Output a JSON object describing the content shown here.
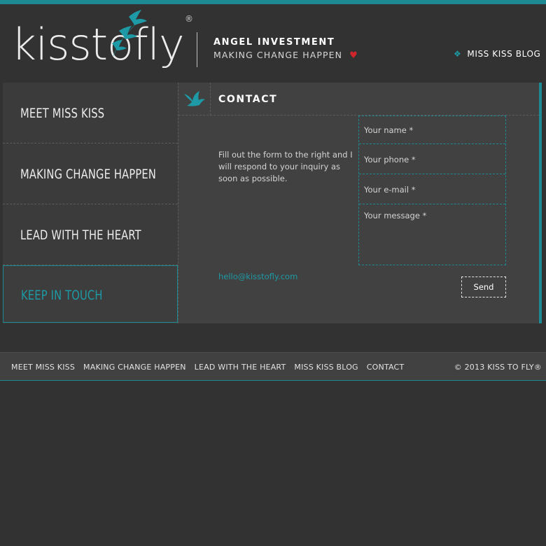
{
  "brand": {
    "logo_text": "kisstofly",
    "registered_mark": "®",
    "logo_icon": "birds-icon",
    "accent_color": "#1d8a93",
    "heart_color": "#d0262b"
  },
  "header": {
    "tagline_primary": "ANGEL INVESTMENT",
    "tagline_secondary": "MAKING CHANGE HAPPEN",
    "heart_icon": "heart-icon",
    "blog_link_icon": "sparkle-icon",
    "blog_link": "MISS KISS BLOG"
  },
  "sidebar": {
    "items": [
      {
        "label": "MEET MISS KISS",
        "active": false
      },
      {
        "label": "MAKING CHANGE HAPPEN",
        "active": false
      },
      {
        "label": "LEAD WITH THE HEART",
        "active": false
      },
      {
        "label": "KEEP IN TOUCH",
        "active": true
      }
    ]
  },
  "contact": {
    "title": "CONTACT",
    "title_icon": "bird-icon",
    "intro": "Fill out the form to the right and I will respond to your inquiry as soon as possible.",
    "email": "hello@kisstofly.com",
    "form": {
      "name_placeholder": "Your name *",
      "phone_placeholder": "Your phone *",
      "email_placeholder": "Your e-mail *",
      "message_placeholder": "Your message *",
      "send_label": "Send"
    }
  },
  "footer": {
    "links": [
      "MEET MISS KISS",
      "MAKING CHANGE HAPPEN",
      "LEAD WITH THE HEART",
      "MISS KISS BLOG",
      "CONTACT"
    ],
    "copyright": "© 2013 KISS TO FLY®"
  }
}
